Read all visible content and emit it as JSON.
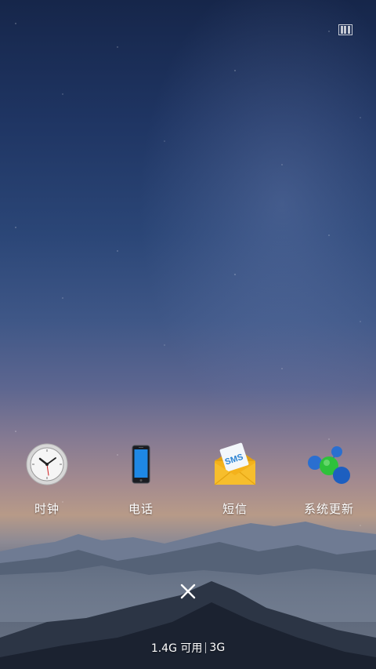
{
  "apps": [
    {
      "label": "时钟",
      "icon": "clock-icon"
    },
    {
      "label": "电话",
      "icon": "phone-icon"
    },
    {
      "label": "短信",
      "icon": "sms-icon"
    },
    {
      "label": "系统更新",
      "icon": "system-update-icon"
    }
  ],
  "sms_icon_text": "SMS",
  "memory": {
    "available": "1.4G 可用",
    "total": "3G"
  },
  "close_icon": "close-icon",
  "status_icon": "recent-apps-icon"
}
